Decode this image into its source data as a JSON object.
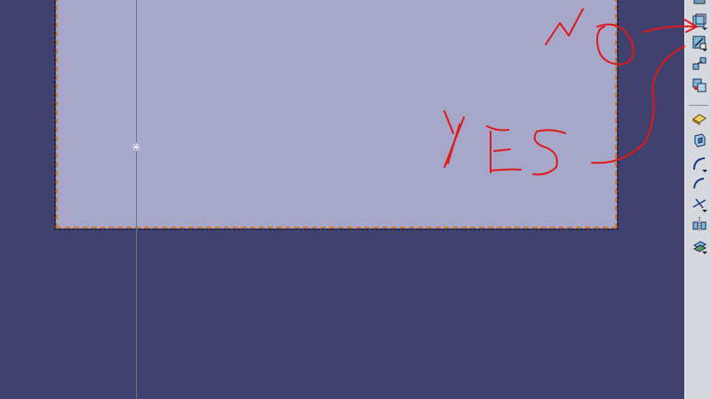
{
  "canvas": {
    "background": "#40416e",
    "sheet_color": "#a7a8c9",
    "sheet_border_color": "#d07a2a",
    "axis_color": "#5f7a7a",
    "origin_marker": "✳"
  },
  "toolbar": {
    "background": "#d7d7de",
    "buttons": [
      {
        "icon": "sketch-face-icon"
      },
      {
        "icon": "sketch-positioned-icon"
      },
      {
        "icon": "constraint-dimension-icon"
      },
      {
        "icon": "copy-geometry-icon"
      },
      {
        "icon": "pad-icon"
      },
      {
        "icon": "pocket-icon"
      },
      {
        "icon": "arc-icon"
      },
      {
        "icon": "spline-icon"
      },
      {
        "icon": "trim-icon"
      },
      {
        "icon": "symmetry-icon"
      },
      {
        "icon": "project-3d-icon"
      }
    ]
  },
  "annotations": {
    "color": "#e01818",
    "no_text": "NO",
    "yes_text": "YES"
  }
}
